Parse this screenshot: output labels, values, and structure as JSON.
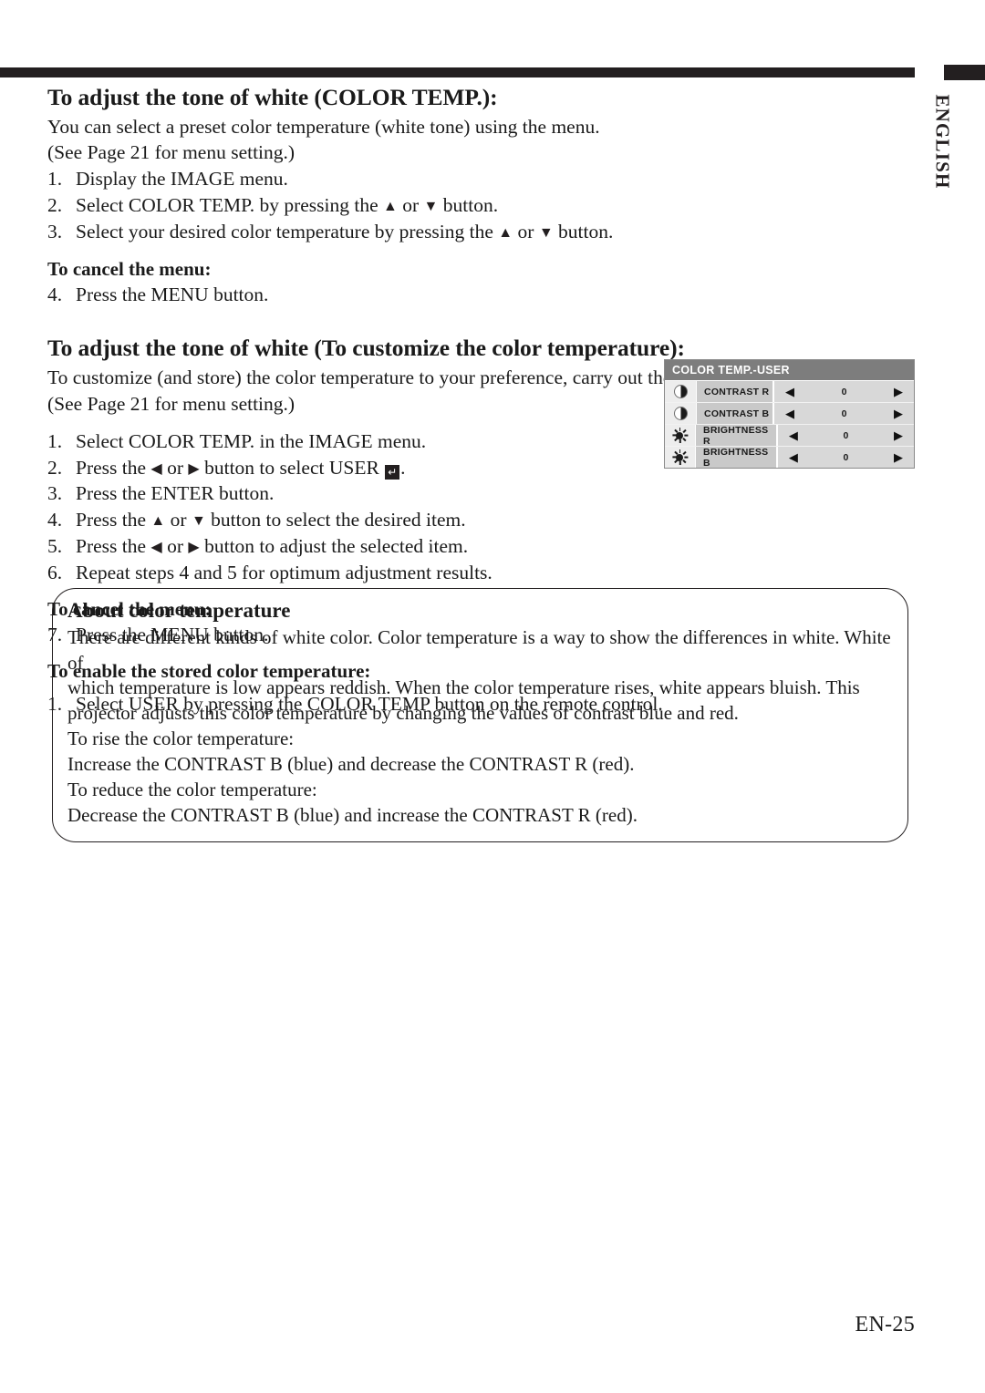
{
  "page": {
    "language_tab": "ENGLISH",
    "page_number": "EN-25"
  },
  "section1": {
    "heading": "To adjust the tone of white (COLOR TEMP.):",
    "intro_line1": "You can select a preset color temperature (white tone) using the menu.",
    "intro_line2": "(See Page 21 for menu setting.)",
    "steps": [
      {
        "num": "1.",
        "pre": "Display the IMAGE menu.",
        "post": ""
      },
      {
        "num": "2.",
        "pre": "Select COLOR TEMP.  by pressing the ",
        "mid": " or ",
        "post": " button."
      },
      {
        "num": "3.",
        "pre": "Select your desired color temperature by pressing the ",
        "mid": " or ",
        "post": " button."
      }
    ],
    "cancel_label": "To cancel the menu:",
    "cancel_step": {
      "num": "4.",
      "text": "Press the MENU button."
    }
  },
  "section2": {
    "heading": "To adjust the tone of white (To customize the color temperature):",
    "intro_line1": "To customize (and store) the color temperature to your preference, carry out the following procedure.",
    "intro_line2": "(See Page 21 for menu setting.)",
    "steps": [
      {
        "num": "1.",
        "pre": "Select COLOR TEMP. in the IMAGE menu.",
        "mid": "",
        "post": ""
      },
      {
        "num": "2.",
        "pre": "Press the ",
        "mid": " or ",
        "post": " button to select USER "
      },
      {
        "num": "3.",
        "pre": "Press the ENTER button.",
        "mid": "",
        "post": ""
      },
      {
        "num": "4.",
        "pre": "Press the ",
        "mid": " or ",
        "post": " button to select the desired item."
      },
      {
        "num": "5.",
        "pre": "Press the ",
        "mid": " or ",
        "post": " button to adjust the selected item."
      },
      {
        "num": "6.",
        "pre": "Repeat steps 4 and 5 for optimum adjustment results.",
        "mid": "",
        "post": ""
      }
    ],
    "cancel_label": "To cancel the menu:",
    "cancel_step": {
      "num": "7.",
      "text": "Press the MENU button."
    },
    "enable_label": "To enable the stored color temperature:",
    "enable_step": {
      "num": "1.",
      "text": "Select USER by pressing the COLOR TEMP button on the remote control."
    }
  },
  "osd_menu": {
    "title": "COLOR TEMP.-USER",
    "left_arrow": "◀",
    "right_arrow": "▶",
    "rows": [
      {
        "icon": "contrast-icon",
        "label": "CONTRAST R",
        "value": "0"
      },
      {
        "icon": "contrast-icon",
        "label": "CONTRAST B",
        "value": "0"
      },
      {
        "icon": "brightness-icon",
        "label": "BRIGHTNESS R",
        "value": "0"
      },
      {
        "icon": "brightness-icon",
        "label": "BRIGHTNESS B",
        "value": "0"
      }
    ],
    "colors": {
      "title_bar": "#7d7d7d",
      "label_cell": "#c9c9c9",
      "value_cell": "#d8d8d8",
      "icon_cell": "#ededed"
    }
  },
  "note_box": {
    "heading": "About color temperature",
    "paragraph_lines": [
      "There are different kinds of white color. Color temperature is a way to show the differences in white. White of",
      "which temperature is low appears reddish. When the color temperature rises, white appears bluish. This",
      "projector adjusts this color temperature by changing the values of contrast blue and red.",
      "To rise the color temperature:",
      "Increase the CONTRAST B (blue) and decrease the CONTRAST R (red).",
      "To reduce the color temperature:",
      "Decrease the CONTRAST B (blue) and increase the CONTRAST R (red)."
    ]
  }
}
